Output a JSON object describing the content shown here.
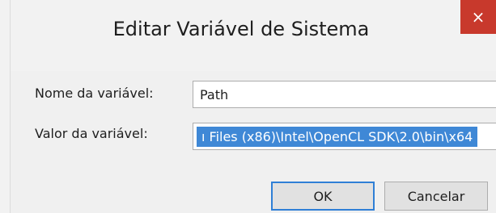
{
  "window": {
    "title": "Editar Variável de Sistema",
    "close_label": "×"
  },
  "form": {
    "name_label": "Nome da variável:",
    "name_value": "Path",
    "value_label": "Valor da variável:",
    "value_value": "ı Files (x86)\\Intel\\OpenCL SDK\\2.0\\bin\\x64"
  },
  "buttons": {
    "ok_label": "OK",
    "cancel_label": "Cancelar"
  },
  "colors": {
    "accent": "#3f88d6",
    "close_bg": "#c8392c"
  }
}
